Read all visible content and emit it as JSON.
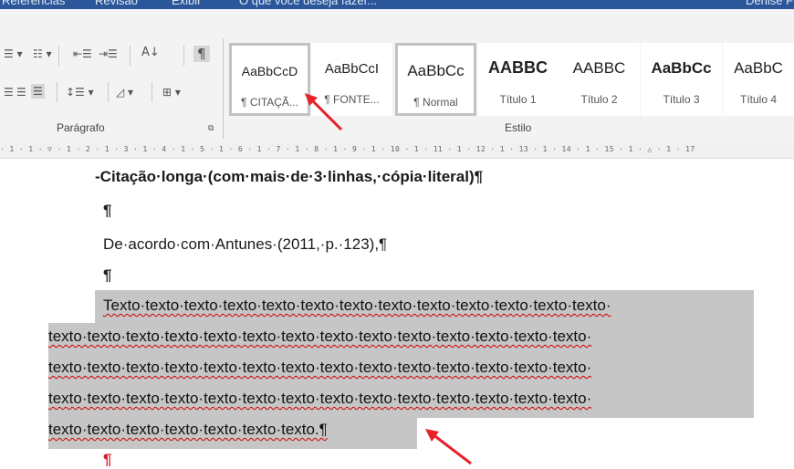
{
  "tabs": [
    "Referências",
    "Revisão",
    "Exibir",
    "O que você deseja fazer...",
    "Denise F"
  ],
  "ribbon": {
    "paragraph_group_label": "Parágrafo",
    "style_group_label": "Estilo",
    "styles": [
      {
        "sample": "AaBbCcD",
        "name": "¶ CITAÇÃ..."
      },
      {
        "sample": "AaBbCcI",
        "name": "¶ FONTE..."
      },
      {
        "sample": "AaBbCc",
        "name": "¶ Normal"
      },
      {
        "sample": "AABBC",
        "name": "Título 1"
      },
      {
        "sample": "AABBC",
        "name": "Título 2"
      },
      {
        "sample": "AaBbCc",
        "name": "Título 3"
      },
      {
        "sample": "AaBbC",
        "name": "Título 4"
      }
    ]
  },
  "ruler": "· 1 · 1 · ▽ · 1 · 2 · 1 · 3 · 1 · 4 · 1 · 5 · 1 · 6 · 1 · 7 · 1 · 8 · 1 · 9 · 1 · 10 · 1 · 11 · 1 · 12 · 1 · 13 · 1 · 14 · 1 · 15 · 1 · △ · 1 · 17",
  "document": {
    "heading": "-Citação·longa·(com·mais·de·3·linhas,·cópia·literal)¶",
    "pilcrow": "¶",
    "intro": "De·acordo·com·Antunes·(2011,·p.·123),¶",
    "quote_lines": [
      "Texto·texto·texto·texto·texto·texto·texto·texto·texto·texto·texto·texto·texto·",
      "texto·texto·texto·texto·texto·texto·texto·texto·texto·texto·texto·texto·texto·texto·",
      "texto·texto·texto·texto·texto·texto·texto·texto·texto·texto·texto·texto·texto·texto·",
      "texto·texto·texto·texto·texto·texto·texto·texto·texto·texto·texto·texto·texto·texto·",
      "texto·texto·texto·texto·texto·texto·texto.¶"
    ]
  },
  "colors": {
    "tab_bar": "#2b579a",
    "highlight": "#c6c6c6",
    "arrow": "#e8202a",
    "spell_underline": "#d00000"
  }
}
